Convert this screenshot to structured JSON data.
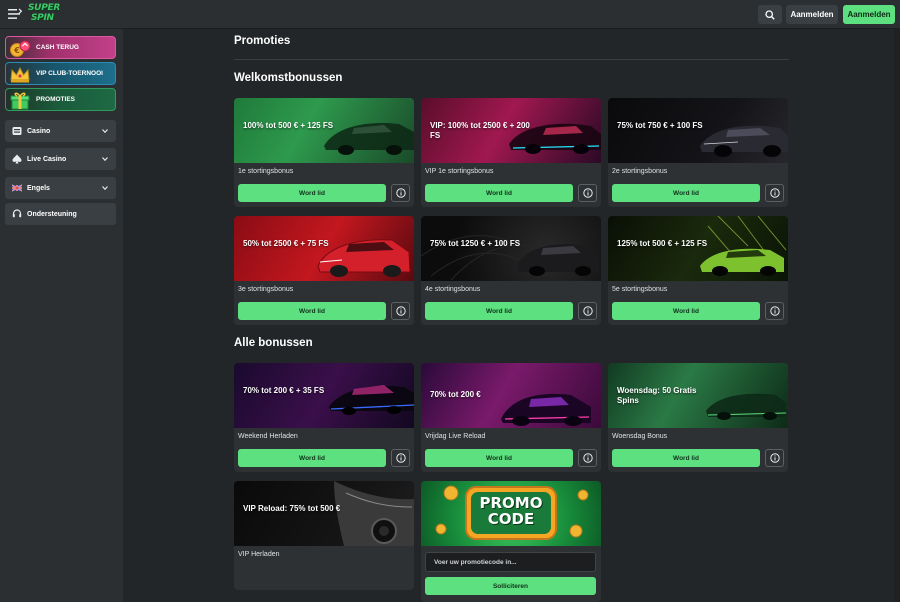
{
  "header": {
    "logo_line1": "SUPER",
    "logo_line2": "SPIN",
    "login_label": "Aanmelden",
    "signup_label": "Aanmelden",
    "search_icon": "search-icon",
    "menu_icon": "hamburger-menu-icon"
  },
  "sidebar": {
    "promos": [
      {
        "label": "CASH TERUG",
        "icon": "cashback-icon",
        "color": "#c2408a"
      },
      {
        "label": "VIP CLUB-TOERNOOI",
        "icon": "crown-icon",
        "color": "#1d6f8c"
      },
      {
        "label": "PROMOTIES",
        "icon": "gift-icon",
        "color": "#1e6a45"
      }
    ],
    "nav": [
      {
        "label": "Casino",
        "icon": "casino-icon"
      },
      {
        "label": "Live Casino",
        "icon": "spade-icon"
      },
      {
        "label": "Engels",
        "icon": "uk-flag-icon"
      },
      {
        "label": "Ondersteuning",
        "icon": "headset-icon"
      }
    ]
  },
  "main": {
    "page_title": "Promoties",
    "welcome_title": "Welkomstbonussen",
    "all_title": "Alle bonussen",
    "join_label": "Word lid",
    "welcome_cards": [
      {
        "banner": "100% tot 500 € + 125 FS",
        "subtitle": "1e stortingsbonus"
      },
      {
        "banner": "VIP: 100% tot 2500 € + 200 FS",
        "subtitle": "VIP 1e stortingsbonus"
      },
      {
        "banner": "75% tot 750 € + 100 FS",
        "subtitle": "2e stortingsbonus"
      },
      {
        "banner": "50% tot 2500 € + 75 FS",
        "subtitle": "3e stortingsbonus"
      },
      {
        "banner": "75% tot 1250 € + 100 FS",
        "subtitle": "4e stortingsbonus"
      },
      {
        "banner": "125% tot 500 € + 125 FS",
        "subtitle": "5e stortingsbonus"
      }
    ],
    "all_cards": [
      {
        "banner": "70% tot 200 € + 35 FS",
        "subtitle": "Weekend Herladen"
      },
      {
        "banner": "70% tot 200 €",
        "subtitle": "Vrijdag Live Reload"
      },
      {
        "banner": "Woensdag: 50 Gratis Spins",
        "subtitle": "Woensdag Bonus"
      },
      {
        "banner": "VIP Reload: 75% tot 500 €",
        "subtitle": "VIP Herladen"
      }
    ],
    "promo_code": {
      "banner_line1": "PROMO",
      "banner_line2": "CODE",
      "placeholder": "Voer uw promotiecode in...",
      "apply_label": "Solliciteren"
    }
  },
  "colors": {
    "accent_green": "#5de07f",
    "background": "#232628",
    "panel": "#2b2f32"
  }
}
